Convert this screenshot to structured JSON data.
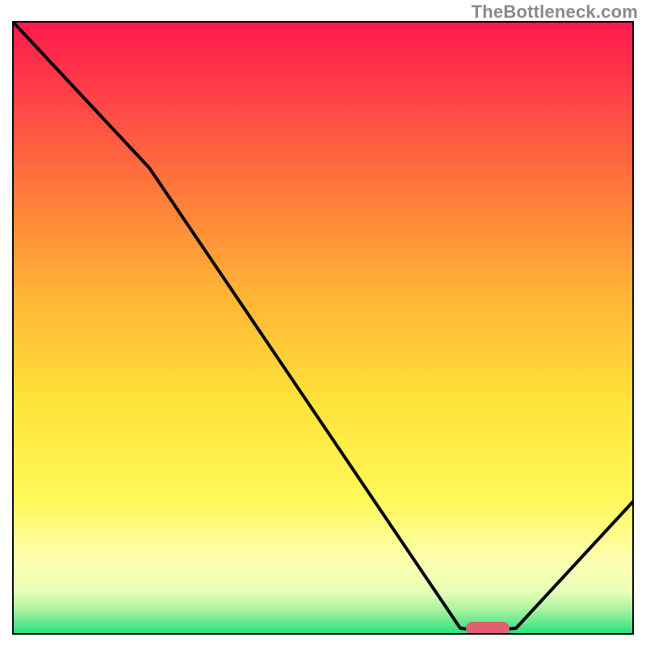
{
  "watermark": {
    "text": "TheBottleneck.com"
  },
  "colors": {
    "gradient_top": "#ff1a4d",
    "gradient_mid1": "#ff9f2a",
    "gradient_mid2": "#ffe73a",
    "gradient_low": "#fffcbf",
    "gradient_bottom": "#23e07a",
    "curve": "#000000",
    "marker": "#e06073",
    "frame": "#000000"
  },
  "chart_data": {
    "type": "line",
    "title": "",
    "xlabel": "",
    "ylabel": "",
    "xlim": [
      0,
      100
    ],
    "ylim": [
      0,
      100
    ],
    "grid": false,
    "legend": false,
    "x": [
      0,
      22,
      72,
      81,
      100
    ],
    "values": [
      100,
      76,
      1,
      1,
      22
    ],
    "marker": {
      "x_range": [
        73,
        80
      ],
      "y": 1
    },
    "notes": "No axis ticks or labels are rendered in the source image; values are estimated from pixel positions."
  }
}
